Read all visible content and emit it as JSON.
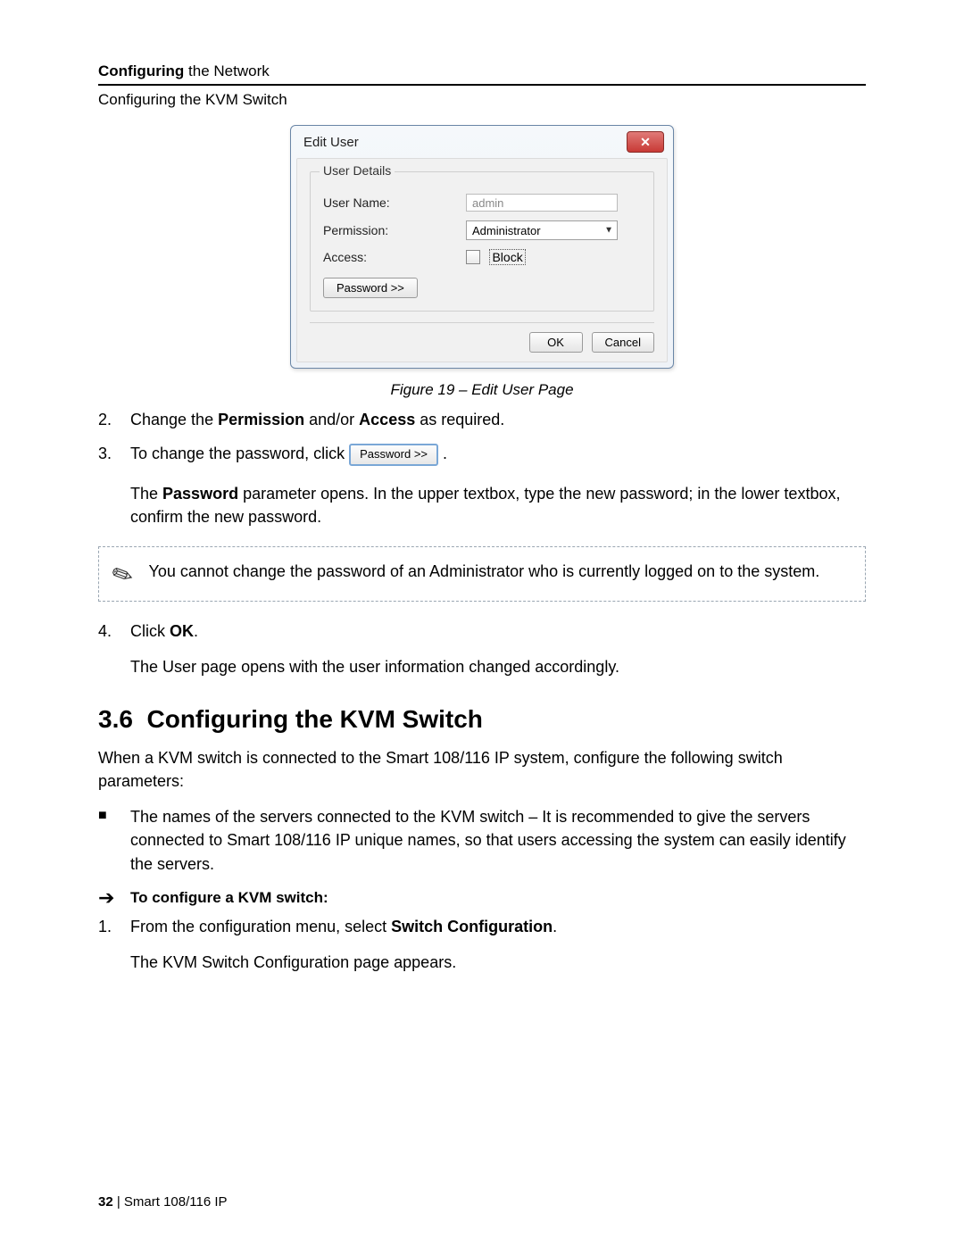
{
  "header": {
    "chapter_bold": "Configuring",
    "chapter_rest": " the Network",
    "subsection": "Configuring the KVM Switch"
  },
  "dialog": {
    "title": "Edit User",
    "close_glyph": "✕",
    "legend": "User Details",
    "username_label": "User Name:",
    "username_value": "admin",
    "permission_label": "Permission:",
    "permission_value": "Administrator",
    "access_label": "Access:",
    "block_label": "Block",
    "password_btn": "Password >>",
    "ok_btn": "OK",
    "cancel_btn": "Cancel"
  },
  "caption": "Figure 19 – Edit User Page",
  "step2": {
    "num": "2.",
    "pre": "Change the ",
    "b1": "Permission",
    "mid": " and/or ",
    "b2": "Access",
    "post": " as required."
  },
  "step3": {
    "num": "3.",
    "pre": "To change the password, click ",
    "btn": "Password >>",
    "post": " .",
    "para_pre": "The ",
    "para_b": "Password",
    "para_post": " parameter opens. In the upper textbox, type the new password; in the lower textbox, confirm the new password."
  },
  "note": "You cannot change the password of an Administrator who is currently logged on to the system.",
  "step4": {
    "num": "4.",
    "pre": "Click ",
    "b": "OK",
    "post": ".",
    "para": "The User page opens with the user information changed accordingly."
  },
  "section": {
    "num": "3.6",
    "title": "Configuring the KVM Switch"
  },
  "intro": "When a KVM switch is connected to the Smart 108/116 IP system, configure the following switch parameters:",
  "bullet": "The names of the servers connected to the KVM switch – It is recommended to give the servers connected to Smart 108/116 IP unique names, so that users accessing the system can easily identify the servers.",
  "task_lead": "To configure a KVM switch:",
  "task1": {
    "num": "1.",
    "pre": "From the configuration menu, select ",
    "b": "Switch Configuration",
    "post": ".",
    "para": "The KVM Switch Configuration page appears."
  },
  "footer": {
    "page": "32",
    "sep": " | ",
    "product": "Smart 108/116 IP"
  }
}
